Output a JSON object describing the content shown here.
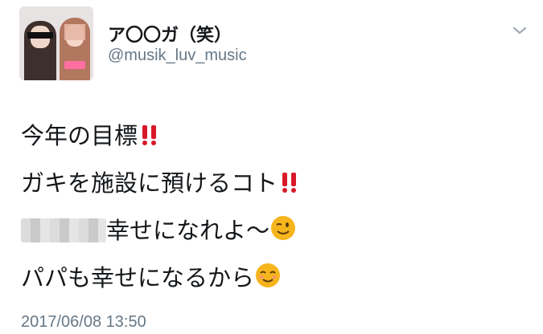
{
  "tweet": {
    "author_name": "ア〇〇ガ（笑）",
    "handle": "@musik_luv_music",
    "lines": [
      "今年の目標",
      "ガキを施設に預けるコト",
      "幸せになれよ〜",
      "パパも幸せになるから"
    ],
    "timestamp": "2017/06/08 13:50"
  },
  "icons": {
    "menu": "chevron-down-icon",
    "exclaim": "double-exclamation-icon",
    "wink": "winking-face-icon",
    "smile": "smiling-face-icon"
  },
  "colors": {
    "text": "#14171a",
    "secondary": "#657786",
    "exclaim": "#d7192a",
    "emoji": "#f6b51d"
  }
}
